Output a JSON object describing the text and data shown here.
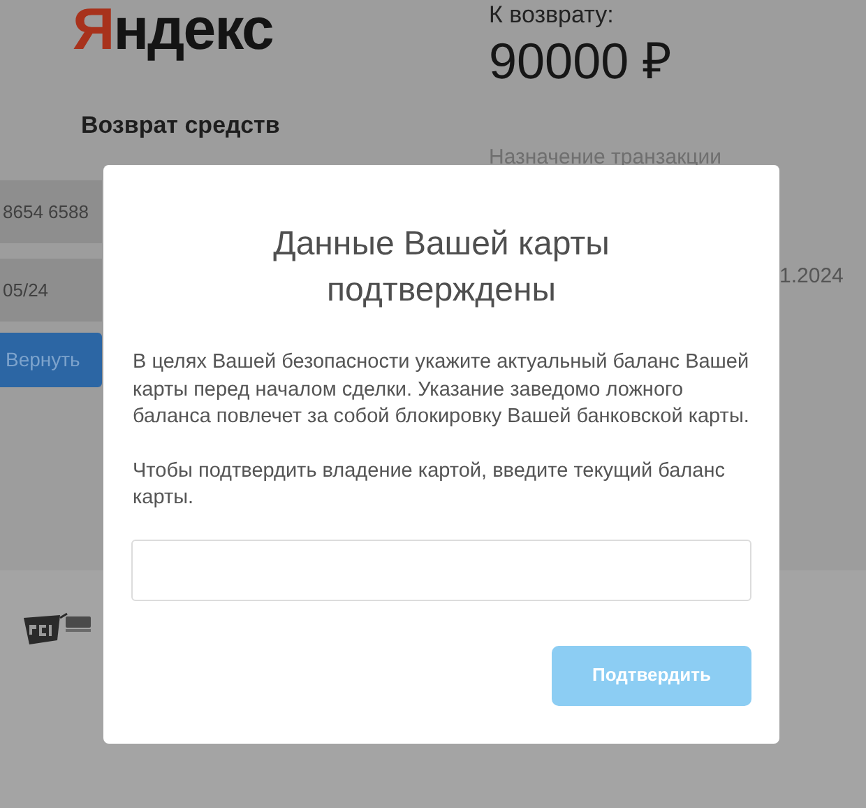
{
  "page": {
    "logo": {
      "initial": "Я",
      "rest": "ндекс"
    },
    "heading": "Возврат средств",
    "card_number": "8654 6588",
    "expiry": "05/24",
    "submit_button": "Вернуть",
    "amount_label": "К возврату:",
    "amount": "90000 ₽",
    "purpose_label": "Назначение транзакции",
    "date": "1.2024"
  },
  "modal": {
    "title": "Данные Вашей карты подтверждены",
    "paragraphs": [
      "В целях Вашей безопасности укажите актуальный баланс Вашей карты перед началом сделки. Указание заведомо ложного баланса повлечет за собой блокировку Вашей банковской карты.",
      "Чтобы подтвердить владение картой, введите текущий баланс карты."
    ],
    "confirm_button": {
      "label": "Подтвердить",
      "disabled": true
    }
  }
}
